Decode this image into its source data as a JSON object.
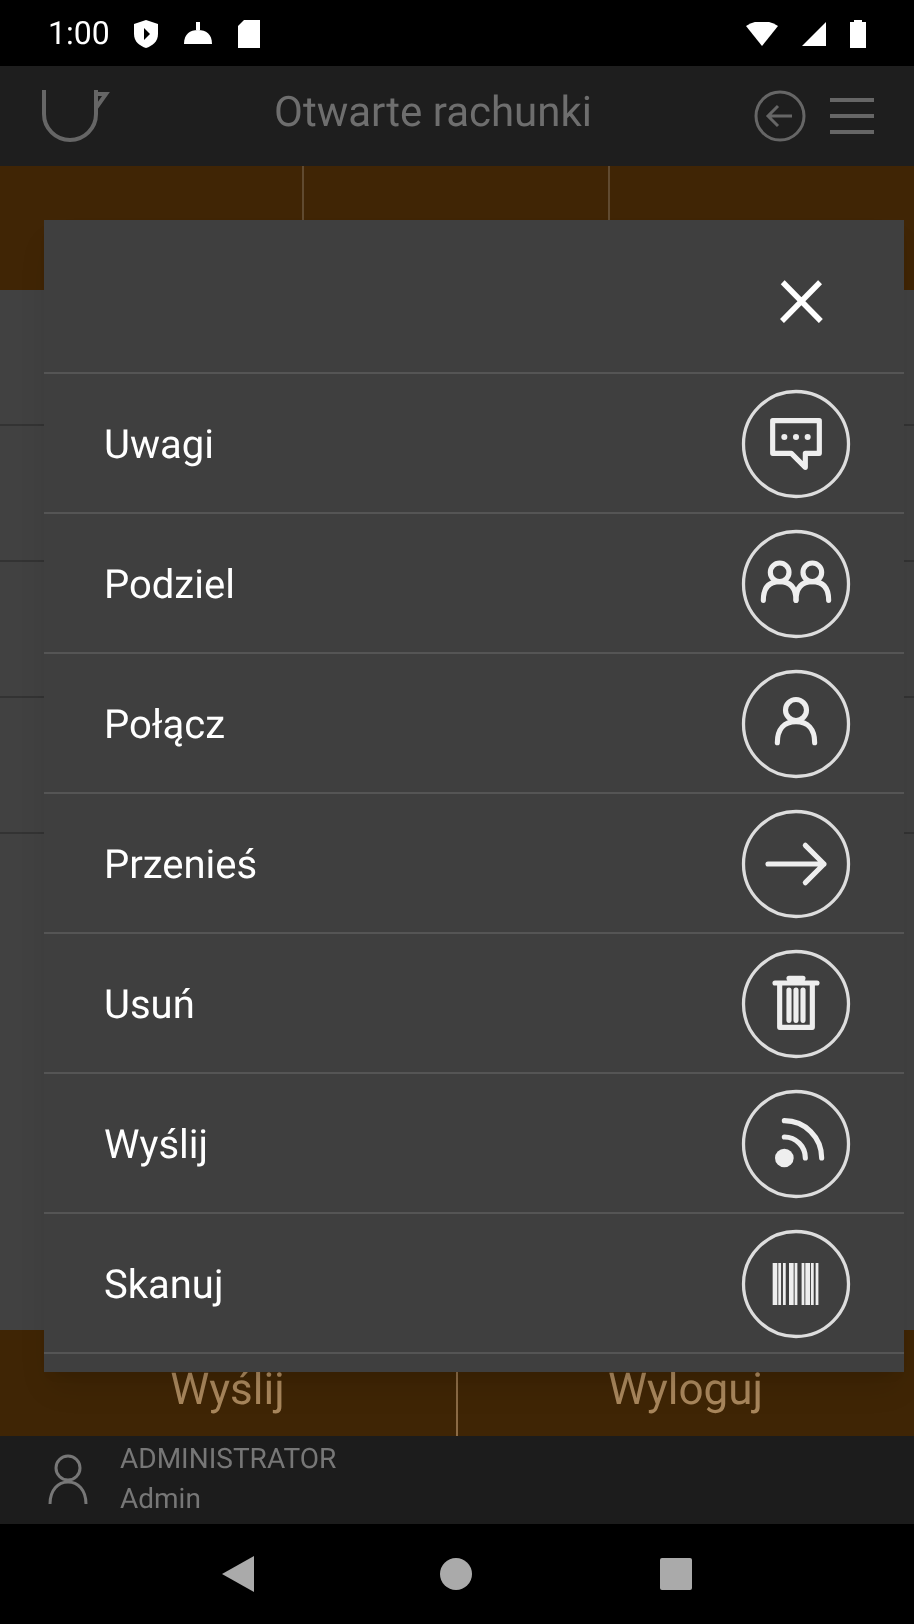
{
  "status_bar": {
    "time": "1:00"
  },
  "app_bar": {
    "title": "Otwarte rachunki"
  },
  "menu": {
    "close": "×",
    "items": [
      {
        "label": "Uwagi",
        "kind": "note"
      },
      {
        "label": "Podziel",
        "kind": "split"
      },
      {
        "label": "Połącz",
        "kind": "merge"
      },
      {
        "label": "Przenieś",
        "kind": "move"
      },
      {
        "label": "Usuń",
        "kind": "delete"
      },
      {
        "label": "Wyślij",
        "kind": "send"
      },
      {
        "label": "Skanuj",
        "kind": "scan"
      }
    ]
  },
  "bottom_buttons": [
    "Wyślij",
    "Wyloguj"
  ],
  "user": {
    "role": "ADMINISTRATOR",
    "name": "Admin"
  }
}
